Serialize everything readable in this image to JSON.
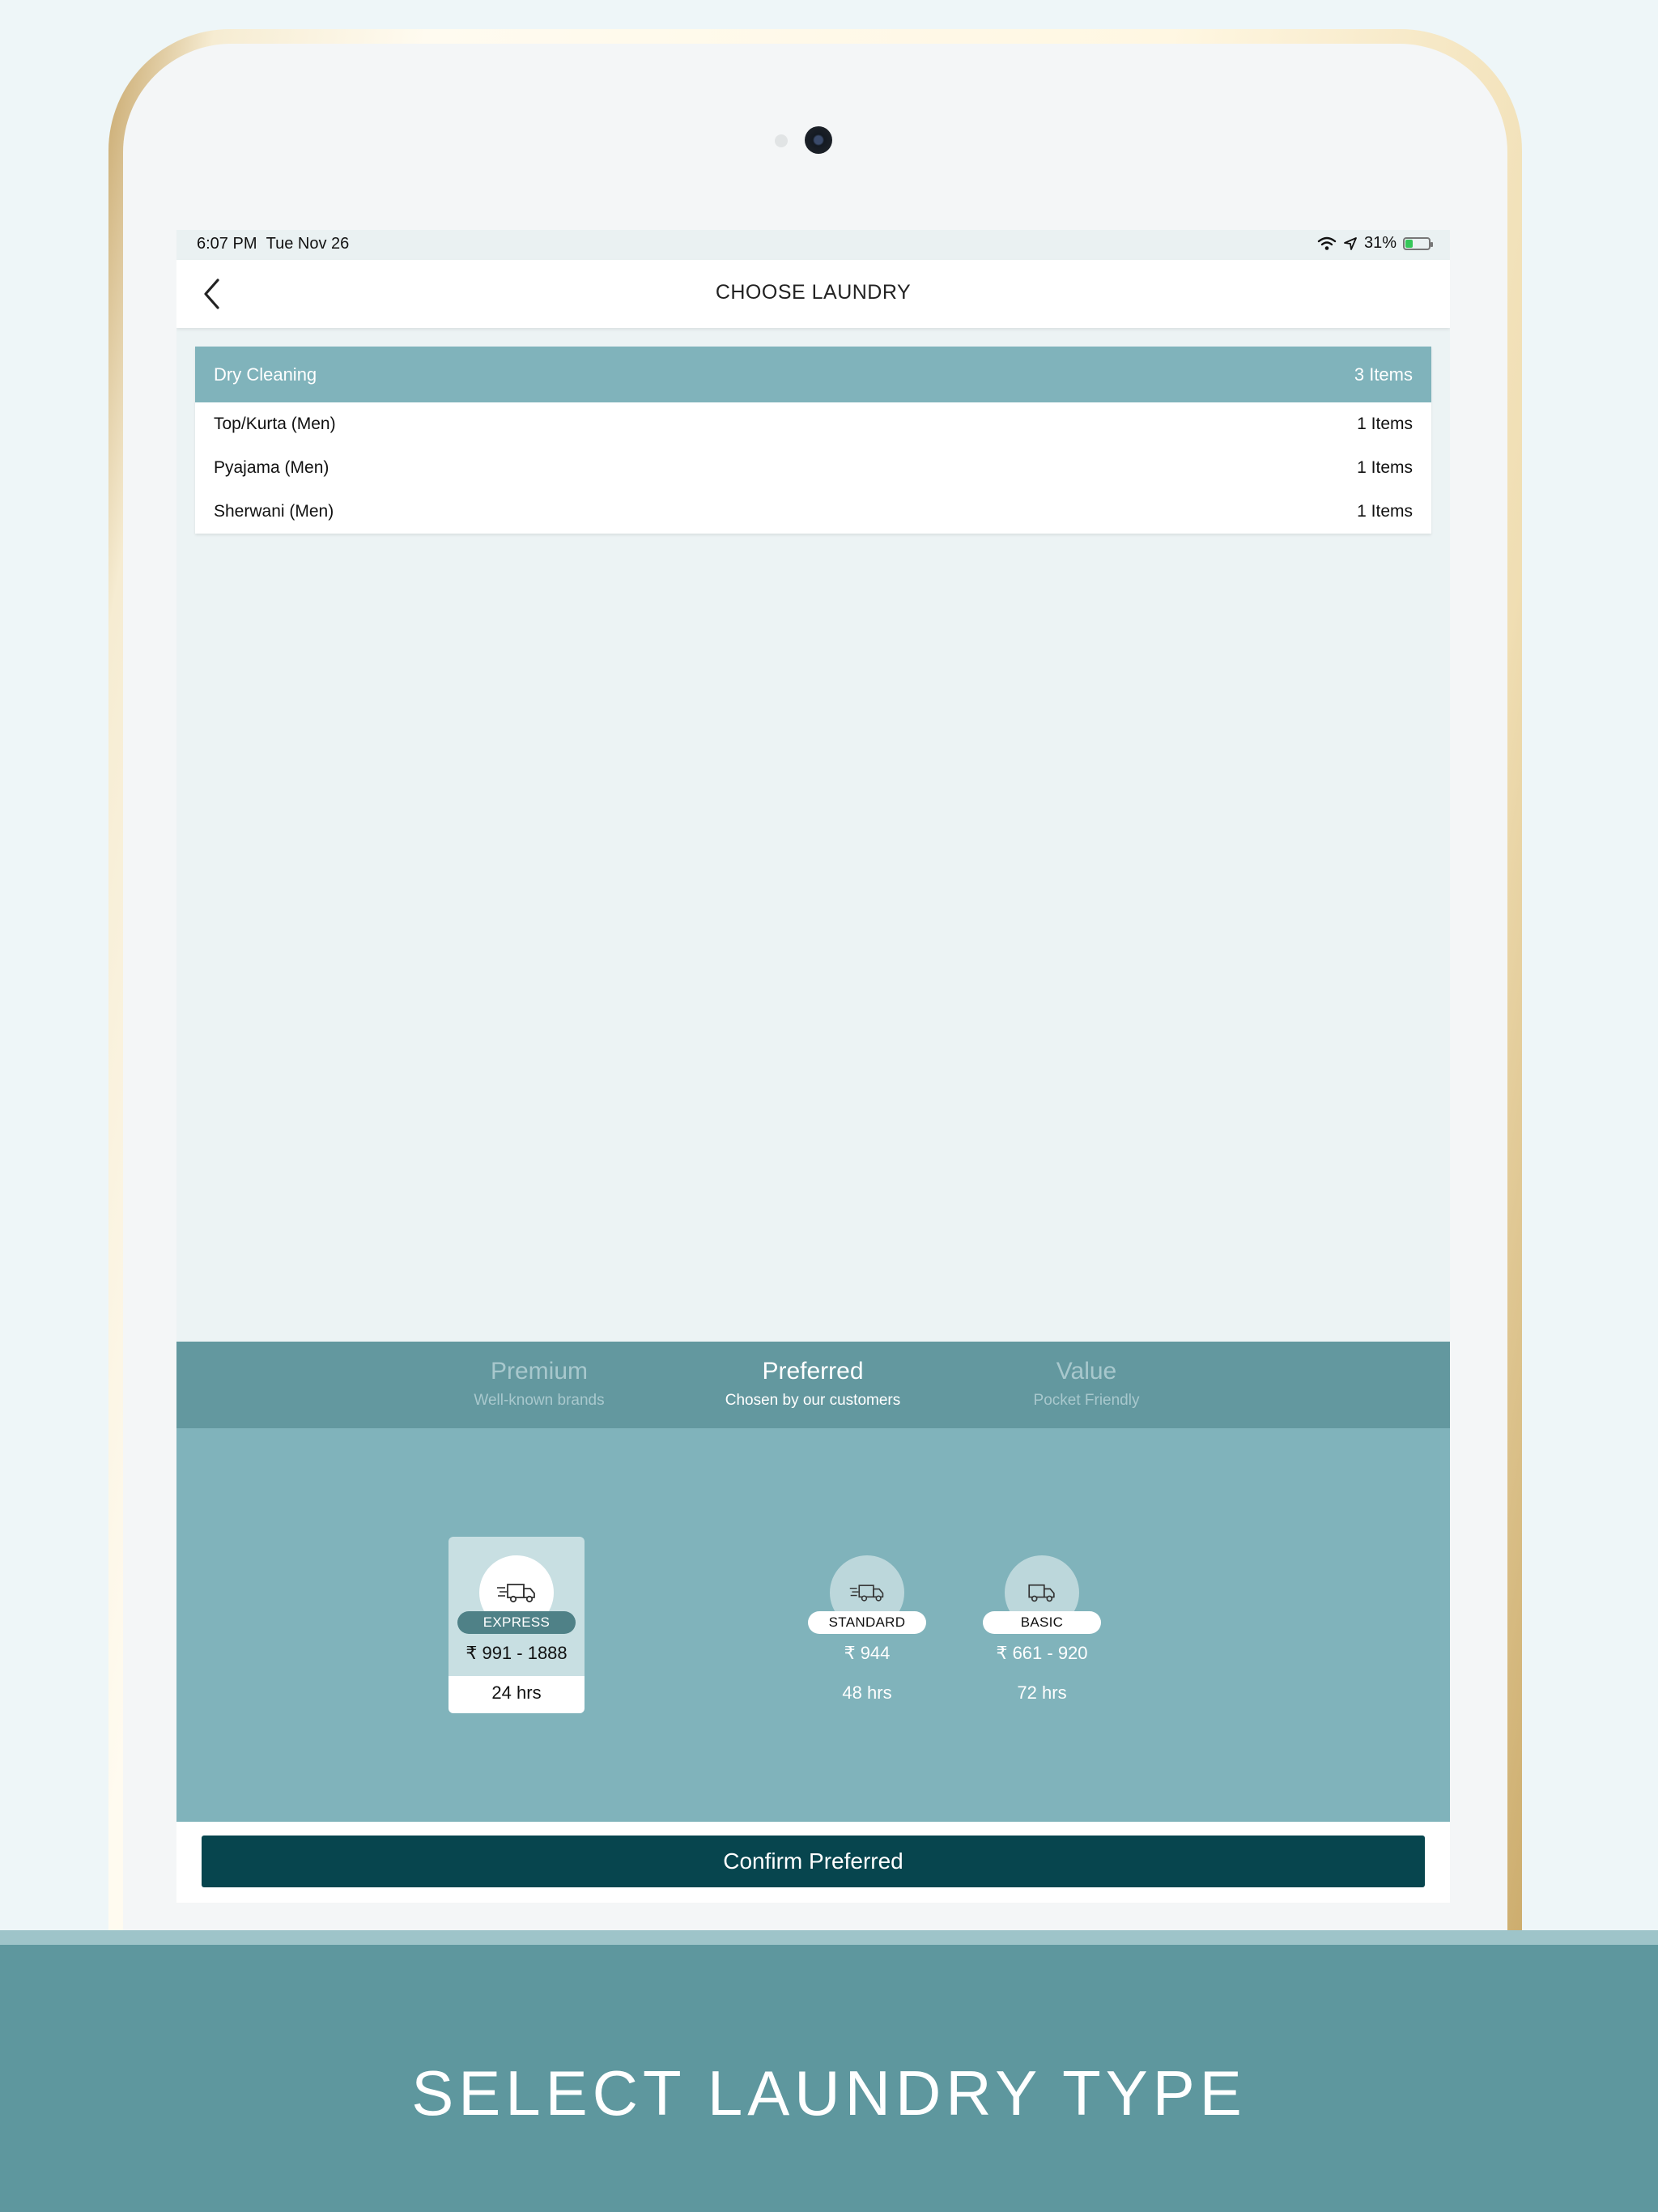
{
  "status_bar": {
    "time": "6:07 PM",
    "date": "Tue Nov 26",
    "battery": "31%"
  },
  "nav": {
    "title": "CHOOSE LAUNDRY",
    "back_icon": "chevron-left-icon"
  },
  "category": {
    "name": "Dry Cleaning",
    "count": "3 Items",
    "items": [
      {
        "name": "Top/Kurta (Men)",
        "count": "1 Items"
      },
      {
        "name": "Pyajama (Men)",
        "count": "1 Items"
      },
      {
        "name": "Sherwani (Men)",
        "count": "1 Items"
      }
    ]
  },
  "tiers": [
    {
      "name": "Premium",
      "subtitle": "Well-known brands",
      "active": false
    },
    {
      "name": "Preferred",
      "subtitle": "Chosen by our customers",
      "active": true
    },
    {
      "name": "Value",
      "subtitle": "Pocket Friendly",
      "active": false
    }
  ],
  "delivery_options": [
    {
      "label": "EXPRESS",
      "price": "₹ 991 - 1888",
      "time": "24 hrs",
      "selected": true,
      "icon": "fast-truck-icon"
    },
    {
      "label": "STANDARD",
      "price": "₹ 944",
      "time": "48 hrs",
      "selected": false,
      "icon": "fast-truck-icon"
    },
    {
      "label": "BASIC",
      "price": "₹ 661 - 920",
      "time": "72 hrs",
      "selected": false,
      "icon": "truck-icon"
    }
  ],
  "confirm_button": "Confirm Preferred",
  "caption": "SELECT LAUNDRY TYPE",
  "colors": {
    "header_teal": "#80b3bb",
    "tab_bar": "#63989f",
    "confirm": "#07454e",
    "caption_band": "#5e979e"
  }
}
